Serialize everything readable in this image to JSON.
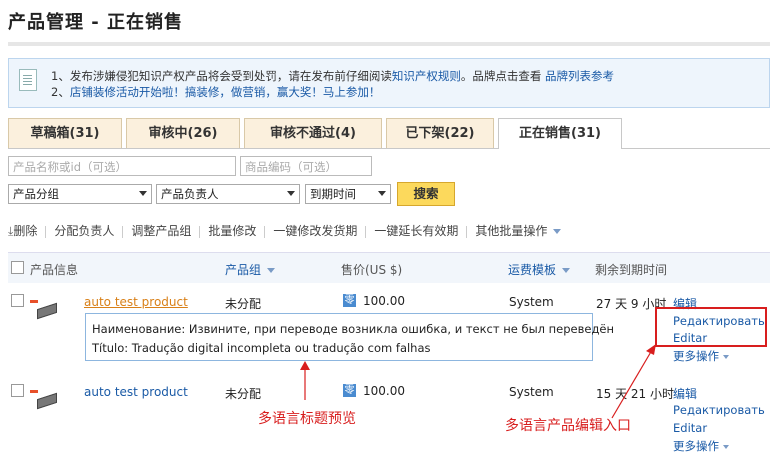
{
  "page": {
    "title": "产品管理 - 正在销售"
  },
  "notice": {
    "line1_prefix": "1、发布涉嫌侵犯知识产权产品将会受到处罚，请在发布前仔细阅读",
    "line1_link1": "知识产权规则",
    "line1_mid": "。品牌点击查看",
    "line1_link2": "品牌列表参考",
    "line2_num": "2、",
    "line2_link1": "店铺装修活动开始啦！",
    "line2_link2": "搞装修，",
    "line2_link3": "做营销，",
    "line2_link4": "赢大奖！",
    "line2_link5": "马上参加！"
  },
  "tabs": [
    {
      "label": "草稿箱(31)"
    },
    {
      "label": "审核中(26)"
    },
    {
      "label": "审核不通过(4)"
    },
    {
      "label": "已下架(22)"
    },
    {
      "label": "正在销售(31)"
    }
  ],
  "filters": {
    "name_placeholder": "产品名称或id（可选）",
    "code_placeholder": "商品编码（可选）",
    "group_select": "产品分组",
    "owner_select": "产品负责人",
    "expiry_select": "到期时间",
    "search_label": "搜索"
  },
  "toolbar": {
    "delete": "删除",
    "assign_owner": "分配负责人",
    "adjust_group": "调整产品组",
    "batch_edit": "批量修改",
    "modify_ship": "一键修改发货期",
    "extend_validity": "一键延长有效期",
    "other_batch": "其他批量操作"
  },
  "table_header": {
    "info": "产品信息",
    "group": "产品组",
    "price": "售价(US $)",
    "shipping": "运费模板",
    "remaining": "剩余到期时间"
  },
  "rows": [
    {
      "name": "auto test product",
      "group": "未分配",
      "price_tag": "零",
      "price": "100.00",
      "shipping": "System",
      "remaining": "27 天 9 小时",
      "edit": "编辑",
      "edit_ru": "Редактировать",
      "edit_pt": "Editar",
      "more": "更多操作"
    },
    {
      "name": "auto test product",
      "group": "未分配",
      "price_tag": "零",
      "price": "100.00",
      "shipping": "System",
      "remaining": "15 天 21 小时",
      "edit": "编辑",
      "edit_ru": "Редактировать",
      "edit_pt": "Editar",
      "more": "更多操作"
    }
  ],
  "preview": {
    "ru": "Наименование:  Извините, при переводе возникла ошибка, и текст не был переведён",
    "pt": "Título: Tradução digital incompleta ou tradução com falhas"
  },
  "annotations": {
    "title_preview": "多语言标题预览",
    "edit_entry": "多语言产品编辑入口"
  },
  "colors": {
    "annotation": "#d81e1e",
    "link": "#1a5aa6",
    "product_link": "#d98018",
    "search_button": "#fcd95c"
  }
}
